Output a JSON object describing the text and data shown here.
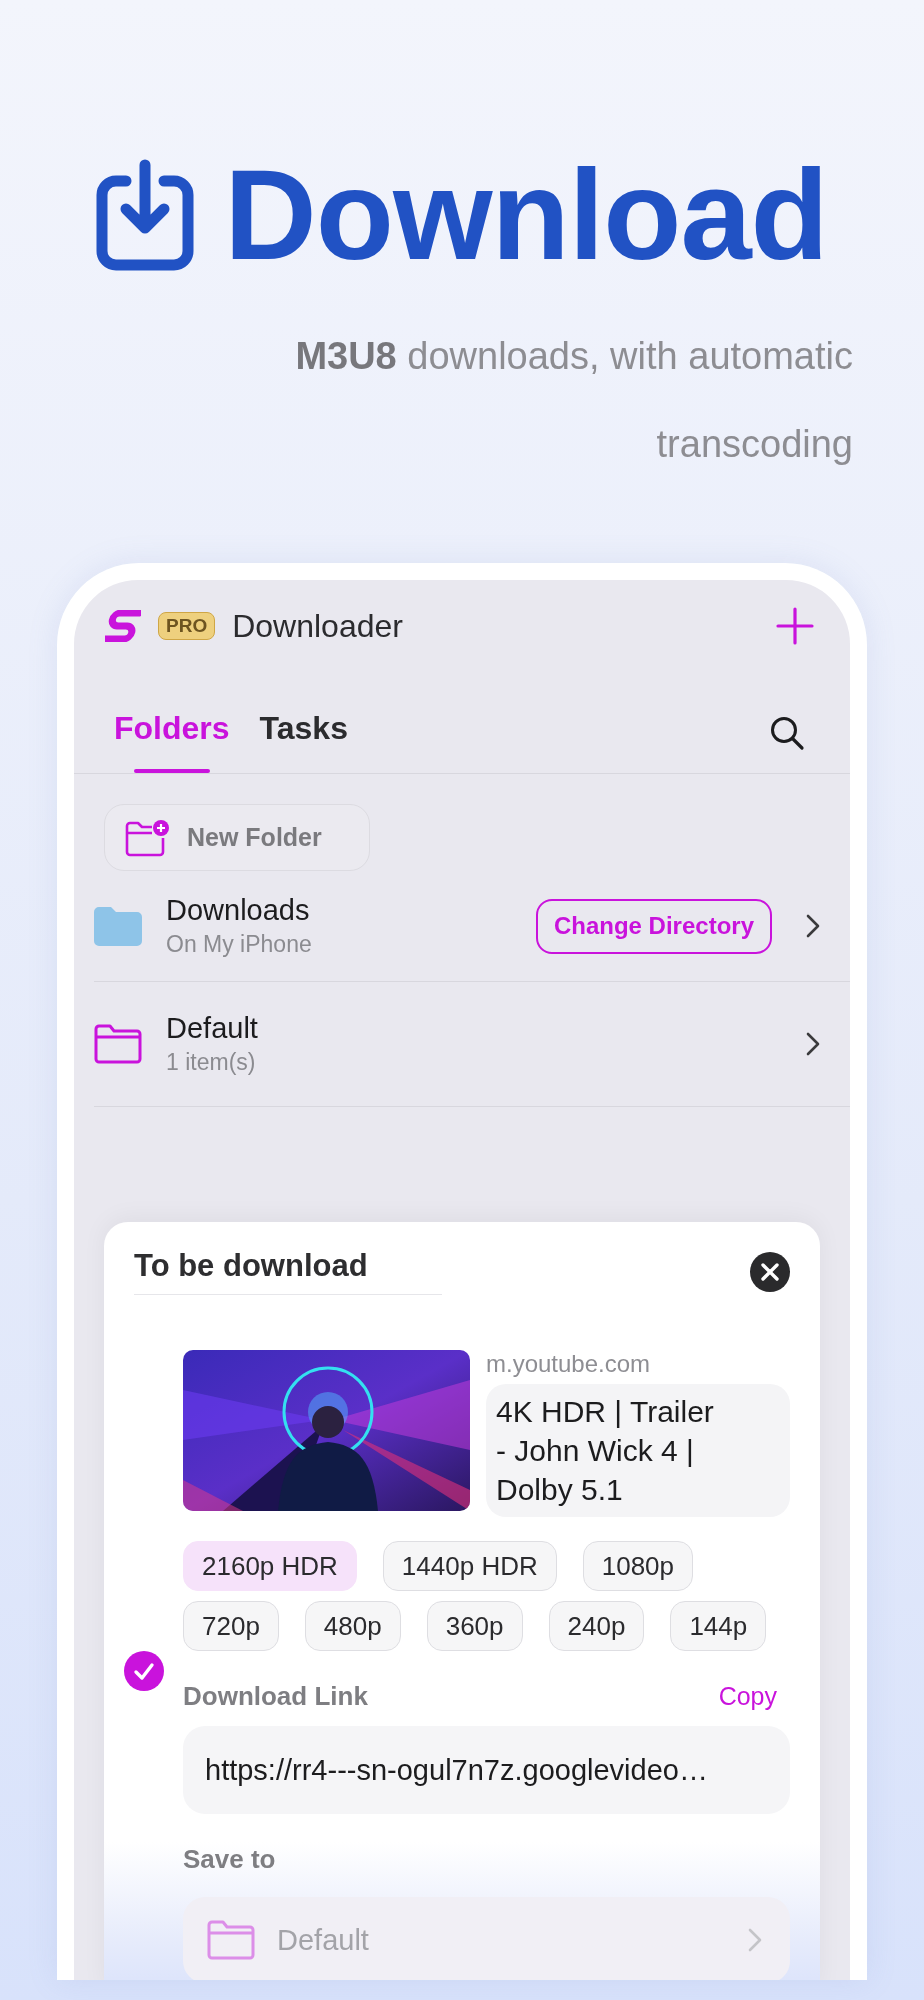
{
  "hero": {
    "title": "Download",
    "subtitle": "**M3U8** downloads, with automatic transcoding"
  },
  "app_header": {
    "badge": "PRO",
    "title": "Downloader"
  },
  "tabs": [
    {
      "label": "Folders",
      "selected": true
    },
    {
      "label": "Tasks",
      "selected": false
    }
  ],
  "new_folder_button": {
    "label": "New Folder"
  },
  "folders": [
    {
      "kind": "storage",
      "name": "Downloads",
      "subtitle": "On My iPhone",
      "action": "Change Directory"
    },
    {
      "kind": "folder",
      "name": "Default",
      "subtitle": "1 item(s)"
    }
  ],
  "sheet": {
    "title": "To be download",
    "video": {
      "source": "m.youtube.com",
      "title": "4K HDR | Trailer - John Wick 4 | Dolby 5.1"
    },
    "qualities": [
      {
        "label": "2160p HDR",
        "selected": true
      },
      {
        "label": "1440p HDR",
        "selected": false
      },
      {
        "label": "1080p",
        "selected": false
      },
      {
        "label": "720p",
        "selected": false
      },
      {
        "label": "480p",
        "selected": false
      },
      {
        "label": "360p",
        "selected": false
      },
      {
        "label": "240p",
        "selected": false
      },
      {
        "label": "144p",
        "selected": false
      }
    ],
    "download_link": {
      "checked": true,
      "label": "Download Link",
      "copy": "Copy",
      "value": "https://rr4---sn-ogul7n7z.googlevideo…"
    },
    "save_to": {
      "label": "Save to",
      "folder": "Default"
    }
  }
}
